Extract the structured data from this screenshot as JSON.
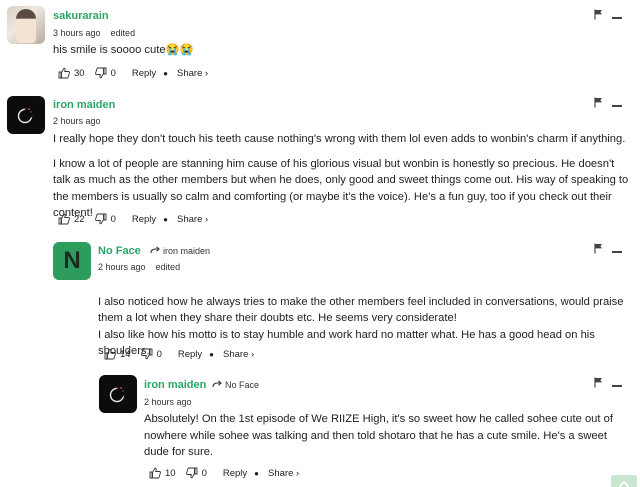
{
  "comments": [
    {
      "name": "sakurarain",
      "time": "3 hours ago",
      "edited": "edited",
      "paragraphs": [
        "his smile is soooo cute😭😭"
      ],
      "likes": "30",
      "dislikes": "0",
      "reply_label": "Reply",
      "share_label": "Share ›",
      "avatar_icon": "photo-avatar"
    },
    {
      "name": "iron maiden",
      "time": "2 hours ago",
      "paragraphs": [
        "I really hope they don't touch his teeth cause nothing's wrong with them lol even adds to wonbin's charm if anything.",
        "I know a lot of people are stanning him cause of his glorious visual but wonbin is honestly so precious. He doesn't talk as much as the other members but when he does, only good and sweet things come out. His way of speaking to the members is usually so calm and comforting (or maybe it's the voice). He's a fun guy, too if you check out their content!"
      ],
      "likes": "22",
      "dislikes": "0",
      "reply_label": "Reply",
      "share_label": "Share ›",
      "avatar_icon": "moon-avatar"
    },
    {
      "name": "No Face",
      "reply_to": "iron maiden",
      "time": "2 hours ago",
      "edited": "edited",
      "avatar_letter": "N",
      "paragraphs": [
        "I also noticed how he always tries to make the other members feel included in conversations, would praise them a lot when they share their doubts etc. He seems very considerate!\nI also like how his motto is to stay humble and work hard no matter what. He has a good head on his shoulders."
      ],
      "likes": "14",
      "dislikes": "0",
      "reply_label": "Reply",
      "share_label": "Share ›"
    },
    {
      "name": "iron maiden",
      "reply_to": "No Face",
      "time": "2 hours ago",
      "paragraphs": [
        "Absolutely! On the 1st episode of We RIIZE High, it's so sweet how he called sohee cute out of nowhere while sohee was talking and then told shotaro that he has a cute smile. He's a sweet dude for sure."
      ],
      "likes": "10",
      "dislikes": "0",
      "reply_label": "Reply",
      "share_label": "Share ›",
      "avatar_icon": "moon-avatar"
    }
  ],
  "colors": {
    "username": "#2aa566",
    "avatar_n": "#2e9c5c",
    "scroll_top": "#c8e6cf"
  }
}
